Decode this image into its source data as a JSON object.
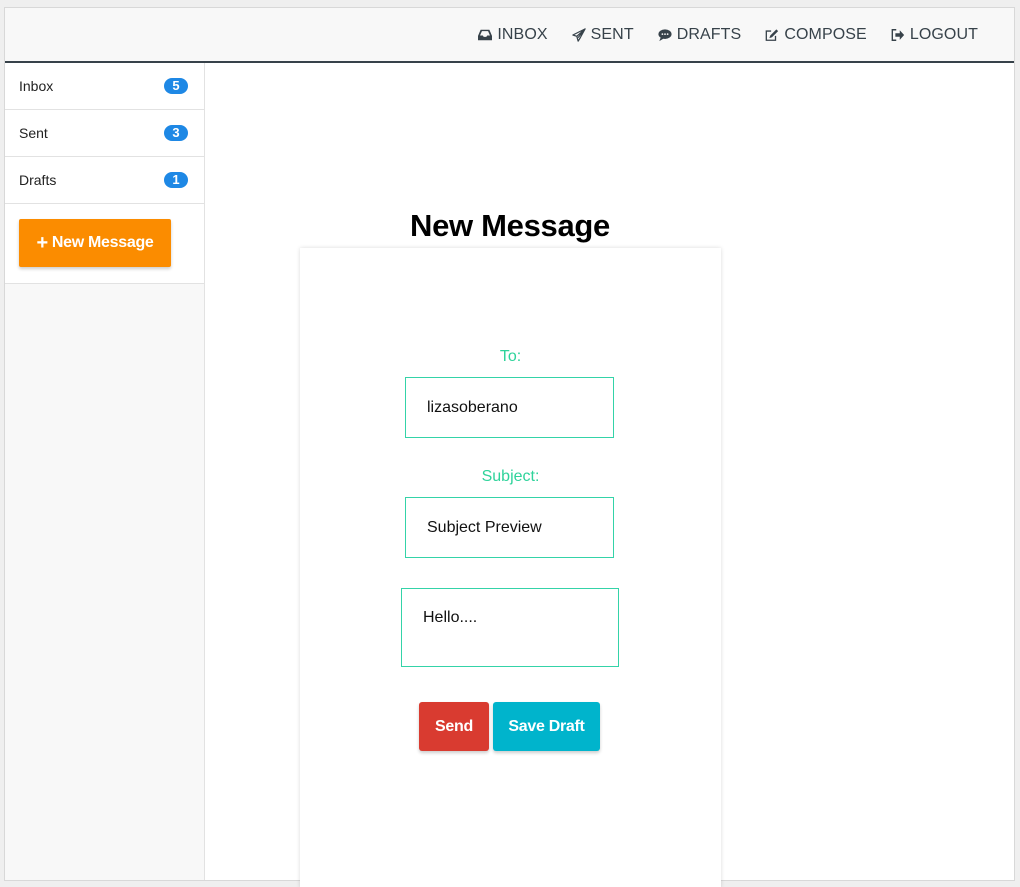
{
  "nav": {
    "items": [
      {
        "label": "INBOX",
        "icon": "inbox-icon"
      },
      {
        "label": "SENT",
        "icon": "paper-plane-icon"
      },
      {
        "label": "DRAFTS",
        "icon": "speech-bubble-icon"
      },
      {
        "label": "COMPOSE",
        "icon": "edit-icon"
      },
      {
        "label": "LOGOUT",
        "icon": "sign-out-icon"
      }
    ]
  },
  "sidebar": {
    "items": [
      {
        "label": "Inbox",
        "count": "5"
      },
      {
        "label": "Sent",
        "count": "3"
      },
      {
        "label": "Drafts",
        "count": "1"
      }
    ],
    "new_message_label": "New Message",
    "new_message_icon": "plus-icon"
  },
  "compose": {
    "title": "New Message",
    "to_label": "To:",
    "to_value": "lizasoberano",
    "subject_label": "Subject:",
    "subject_value": "Subject Preview",
    "body_value": "Hello....",
    "send_label": "Send",
    "save_draft_label": "Save Draft"
  },
  "colors": {
    "accent_green": "#2fd39b",
    "badge_blue": "#1e88e5",
    "new_message_orange": "#fb8c00",
    "send_red": "#d93b30",
    "save_draft_cyan": "#00b4cc",
    "navbar_border": "#37424a"
  }
}
